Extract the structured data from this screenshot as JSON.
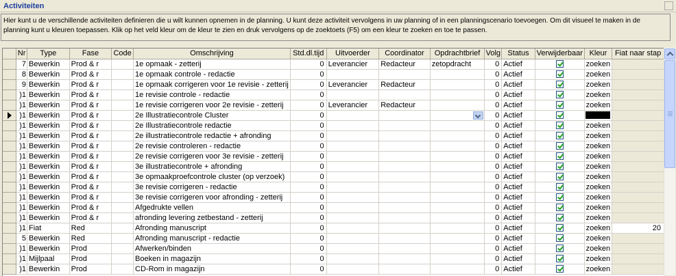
{
  "window": {
    "title": "Activiteiten"
  },
  "description": "Hier kunt u de verschillende activiteiten definieren die u wilt kunnen opnemen in de planning. U kunt deze activiteit vervolgens in uw planning of in een planningscenario toevoegen. Om dit visueel te maken in de planning kunt u kleuren toepassen. Klik op het veld kleur om de kleur te zien en druk vervolgens op de zoektoets (F5) om een kleur te zoeken en toe te passen.",
  "columns": [
    "",
    "Nr",
    "Type",
    "Fase",
    "Code",
    "Omschrijving",
    "Std.dl.tijd",
    "Uitvoerder",
    "Coordinator",
    "Opdrachtbrief",
    "Volg",
    "Status",
    "Verwijderbaar",
    "Kleur",
    "Fiat naar stap"
  ],
  "rows": [
    {
      "nr": "7",
      "type": "Bewerkin",
      "fase": "Prod & r",
      "code": "",
      "omschrijving": "1e opmaak - zetterij",
      "std": "0",
      "uitvoerder": "Leverancier",
      "coordinator": "Redacteur",
      "opdrachtbrief": "zetopdracht",
      "volg": "0",
      "status": "Actief",
      "verwijderbaar": true,
      "kleur": "zoeken",
      "fiat": ""
    },
    {
      "nr": "8",
      "type": "Bewerkin",
      "fase": "Prod & r",
      "code": "",
      "omschrijving": "1e opmaak controle - redactie",
      "std": "0",
      "uitvoerder": "",
      "coordinator": "",
      "opdrachtbrief": "",
      "volg": "0",
      "status": "Actief",
      "verwijderbaar": true,
      "kleur": "zoeken",
      "fiat": ""
    },
    {
      "nr": "9",
      "type": "Bewerkin",
      "fase": "Prod & r",
      "code": "",
      "omschrijving": "1e opmaak corrigeren voor 1e revisie - zetterij",
      "std": "0",
      "uitvoerder": "Leverancier",
      "coordinator": "Redacteur",
      "opdrachtbrief": "",
      "volg": "0",
      "status": "Actief",
      "verwijderbaar": true,
      "kleur": "zoeken",
      "fiat": ""
    },
    {
      "nr": ")1",
      "type": "Bewerkin",
      "fase": "Prod & r",
      "code": "",
      "omschrijving": "1e revisie controle - redactie",
      "std": "0",
      "uitvoerder": "",
      "coordinator": "",
      "opdrachtbrief": "",
      "volg": "0",
      "status": "Actief",
      "verwijderbaar": true,
      "kleur": "zoeken",
      "fiat": ""
    },
    {
      "nr": ")1",
      "type": "Bewerkin",
      "fase": "Prod & r",
      "code": "",
      "omschrijving": "1e revisie corrigeren voor 2e revisie - zetterij",
      "std": "0",
      "uitvoerder": "Leverancier",
      "coordinator": "Redacteur",
      "opdrachtbrief": "",
      "volg": "0",
      "status": "Actief",
      "verwijderbaar": true,
      "kleur": "zoeken",
      "fiat": ""
    },
    {
      "nr": ")1",
      "type": "Bewerkin",
      "fase": "Prod & r",
      "code": "",
      "omschrijving": "2e Illustratiecontrole Cluster",
      "std": "0",
      "uitvoerder": "",
      "coordinator": "",
      "opdrachtbrief": "",
      "volg": "0",
      "status": "Actief",
      "verwijderbaar": true,
      "kleur": "",
      "fiat": "",
      "current": true
    },
    {
      "nr": ")1",
      "type": "Bewerkin",
      "fase": "Prod & r",
      "code": "",
      "omschrijving": "2e Illustratiecontrole redactie",
      "std": "0",
      "uitvoerder": "",
      "coordinator": "",
      "opdrachtbrief": "",
      "volg": "0",
      "status": "Actief",
      "verwijderbaar": true,
      "kleur": "zoeken",
      "fiat": ""
    },
    {
      "nr": ")1",
      "type": "Bewerkin",
      "fase": "Prod & r",
      "code": "",
      "omschrijving": "2e illustratiecontrole redactie + afronding",
      "std": "0",
      "uitvoerder": "",
      "coordinator": "",
      "opdrachtbrief": "",
      "volg": "0",
      "status": "Actief",
      "verwijderbaar": true,
      "kleur": "zoeken",
      "fiat": ""
    },
    {
      "nr": ")1",
      "type": "Bewerkin",
      "fase": "Prod & r",
      "code": "",
      "omschrijving": "2e revisie controleren - redactie",
      "std": "0",
      "uitvoerder": "",
      "coordinator": "",
      "opdrachtbrief": "",
      "volg": "0",
      "status": "Actief",
      "verwijderbaar": true,
      "kleur": "zoeken",
      "fiat": ""
    },
    {
      "nr": ")1",
      "type": "Bewerkin",
      "fase": "Prod & r",
      "code": "",
      "omschrijving": "2e revisie corrigeren voor 3e revisie - zetterij",
      "std": "0",
      "uitvoerder": "",
      "coordinator": "",
      "opdrachtbrief": "",
      "volg": "0",
      "status": "Actief",
      "verwijderbaar": true,
      "kleur": "zoeken",
      "fiat": ""
    },
    {
      "nr": ")1",
      "type": "Bewerkin",
      "fase": "Prod & r",
      "code": "",
      "omschrijving": "3e illustratiecontrole + afronding",
      "std": "0",
      "uitvoerder": "",
      "coordinator": "",
      "opdrachtbrief": "",
      "volg": "0",
      "status": "Actief",
      "verwijderbaar": true,
      "kleur": "zoeken",
      "fiat": ""
    },
    {
      "nr": ")1",
      "type": "Bewerkin",
      "fase": "Prod & r",
      "code": "",
      "omschrijving": "3e opmaakproefcontrole cluster (op verzoek)",
      "std": "0",
      "uitvoerder": "",
      "coordinator": "",
      "opdrachtbrief": "",
      "volg": "0",
      "status": "Actief",
      "verwijderbaar": true,
      "kleur": "zoeken",
      "fiat": ""
    },
    {
      "nr": ")1",
      "type": "Bewerkin",
      "fase": "Prod & r",
      "code": "",
      "omschrijving": "3e revisie corrigeren - redactie",
      "std": "0",
      "uitvoerder": "",
      "coordinator": "",
      "opdrachtbrief": "",
      "volg": "0",
      "status": "Actief",
      "verwijderbaar": true,
      "kleur": "zoeken",
      "fiat": ""
    },
    {
      "nr": ")1",
      "type": "Bewerkin",
      "fase": "Prod & r",
      "code": "",
      "omschrijving": "3e revisie corrigeren voor afronding - zetterij",
      "std": "0",
      "uitvoerder": "",
      "coordinator": "",
      "opdrachtbrief": "",
      "volg": "0",
      "status": "Actief",
      "verwijderbaar": true,
      "kleur": "zoeken",
      "fiat": ""
    },
    {
      "nr": ")1",
      "type": "Bewerkin",
      "fase": "Prod & r",
      "code": "",
      "omschrijving": "Afgedrukte vellen",
      "std": "0",
      "uitvoerder": "",
      "coordinator": "",
      "opdrachtbrief": "",
      "volg": "0",
      "status": "Actief",
      "verwijderbaar": true,
      "kleur": "zoeken",
      "fiat": ""
    },
    {
      "nr": ")1",
      "type": "Bewerkin",
      "fase": "Prod & r",
      "code": "",
      "omschrijving": "afronding levering zetbestand - zetterij",
      "std": "0",
      "uitvoerder": "",
      "coordinator": "",
      "opdrachtbrief": "",
      "volg": "0",
      "status": "Actief",
      "verwijderbaar": true,
      "kleur": "zoeken",
      "fiat": ""
    },
    {
      "nr": ")1",
      "type": "Fiat",
      "fase": "Red",
      "code": "",
      "omschrijving": "Afronding manuscript",
      "std": "0",
      "uitvoerder": "",
      "coordinator": "",
      "opdrachtbrief": "",
      "volg": "0",
      "status": "Actief",
      "verwijderbaar": true,
      "kleur": "zoeken",
      "fiat": "20"
    },
    {
      "nr": "5",
      "type": "Bewerkin",
      "fase": "Red",
      "code": "",
      "omschrijving": "Afronding manuscript - redactie",
      "std": "0",
      "uitvoerder": "",
      "coordinator": "",
      "opdrachtbrief": "",
      "volg": "0",
      "status": "Actief",
      "verwijderbaar": true,
      "kleur": "zoeken",
      "fiat": ""
    },
    {
      "nr": ")1",
      "type": "Bewerkin",
      "fase": "Prod",
      "code": "",
      "omschrijving": "Afwerken/binden",
      "std": "0",
      "uitvoerder": "",
      "coordinator": "",
      "opdrachtbrief": "",
      "volg": "0",
      "status": "Actief",
      "verwijderbaar": true,
      "kleur": "zoeken",
      "fiat": ""
    },
    {
      "nr": ")1",
      "type": "Mijlpaal",
      "fase": "Prod",
      "code": "",
      "omschrijving": "Boeken in magazijn",
      "std": "0",
      "uitvoerder": "",
      "coordinator": "",
      "opdrachtbrief": "",
      "volg": "0",
      "status": "Actief",
      "verwijderbaar": true,
      "kleur": "zoeken",
      "fiat": ""
    },
    {
      "nr": ")1",
      "type": "Bewerkin",
      "fase": "Prod",
      "code": "",
      "omschrijving": "CD-Rom in magazijn",
      "std": "0",
      "uitvoerder": "",
      "coordinator": "",
      "opdrachtbrief": "",
      "volg": "0",
      "status": "Actief",
      "verwijderbaar": true,
      "kleur": "zoeken",
      "fiat": ""
    }
  ]
}
